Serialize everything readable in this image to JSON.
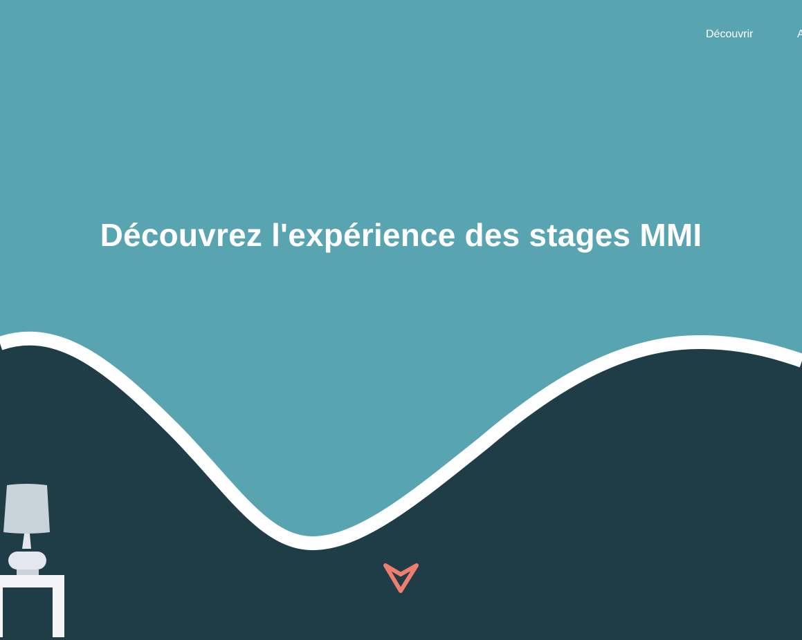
{
  "nav": {
    "links": [
      {
        "label": "Découvrir"
      },
      {
        "label": "A"
      }
    ]
  },
  "hero": {
    "title": "Découvrez l'expérience des stages MMI"
  },
  "colors": {
    "sky": "#58a4b1",
    "ground": "#1f3d46",
    "wave_stroke": "#ffffff",
    "arrow": "#f07e6e",
    "lamp_shade": "#c9d3da",
    "lamp_body": "#e4e7ef",
    "table": "#f4f4f6"
  },
  "icons": {
    "scroll": "chevron-down-icon",
    "decor": "lamp-icon"
  }
}
